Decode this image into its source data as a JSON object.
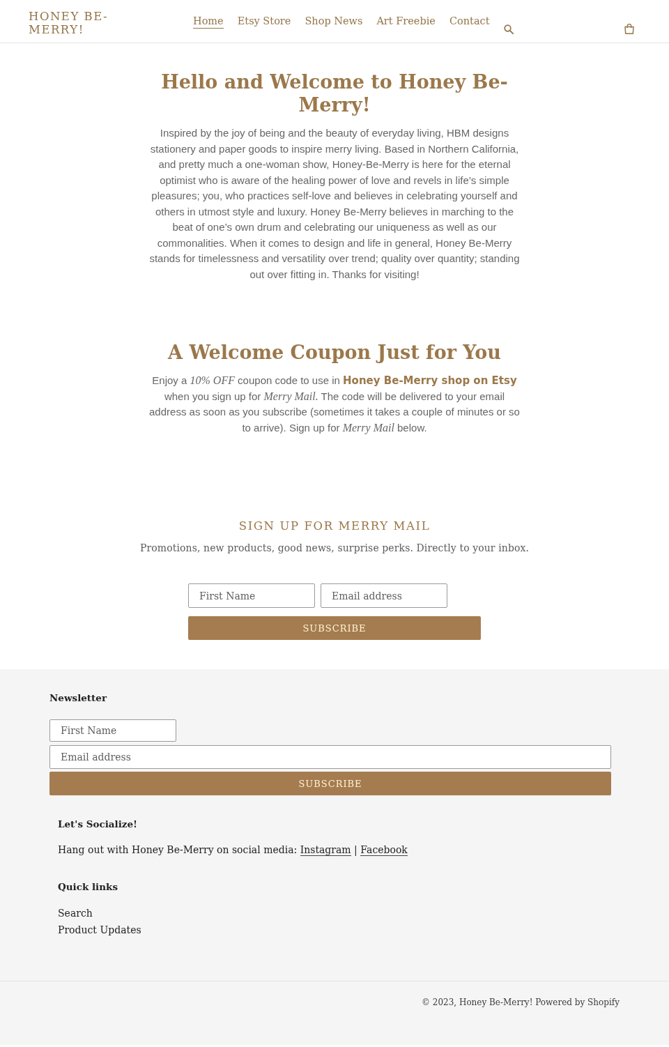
{
  "header": {
    "logo": "HONEY BE-MERRY!",
    "nav": [
      {
        "label": "Home",
        "selected": true
      },
      {
        "label": "Etsy Store",
        "selected": false
      },
      {
        "label": "Shop News",
        "selected": false
      },
      {
        "label": "Art Freebie",
        "selected": false
      },
      {
        "label": "Contact",
        "selected": false
      }
    ]
  },
  "intro": {
    "title": "Hello and Welcome to Honey Be-Merry!",
    "body": "Inspired by the joy of being and the beauty of everyday living, HBM designs stationery and paper goods to inspire merry living. Based in Northern California, and pretty much a one-woman show, Honey-Be-Merry is here for the eternal optimist who is aware of the healing power of love and revels in life’s simple pleasures; you, who practices self-love and believes in celebrating yourself and others in utmost style and luxury. Honey Be-Merry believes in marching to the beat of one’s own drum and celebrating our uniqueness as well as our commonalities. When it comes to design and life in general, Honey Be-Merry stands for timelessness and versatility over trend; quality over quantity; standing out over fitting in. Thanks for visiting!"
  },
  "coupon": {
    "title": "A Welcome Coupon Just for You",
    "body": "Enjoy a *10% OFF* coupon code to use in **Honey Be-Merry shop on Etsy** when you sign up for *Merry Mail.* The code will be delivered to your email address as soon as you subscribe (sometimes it takes a couple of minutes or so to arrive). Sign up for *Merry Mail* below."
  },
  "signup": {
    "title": "SIGN UP FOR MERRY MAIL",
    "subtitle": "Promotions, new products, good news, surprise perks. Directly to your inbox.",
    "first_name": {
      "placeholder": "First Name"
    },
    "email": {
      "placeholder": "Email address"
    },
    "button": "SUBSCRIBE"
  },
  "footer": {
    "newsletter": {
      "title": "Newsletter",
      "first_name": {
        "placeholder": "First Name"
      },
      "email": {
        "placeholder": "Email address"
      },
      "button": "SUBSCRIBE"
    },
    "social": {
      "title": "Let's Socialize!",
      "text": "Hang out with Honey Be-Merry on social media:",
      "links": [
        "Instagram",
        "Facebook"
      ],
      "separator": "|"
    },
    "quick_links": {
      "title": "Quick links",
      "links": [
        "Search",
        "Product Updates"
      ]
    },
    "copyright": "© 2023, Honey Be-Merry! Powered by Shopify"
  }
}
